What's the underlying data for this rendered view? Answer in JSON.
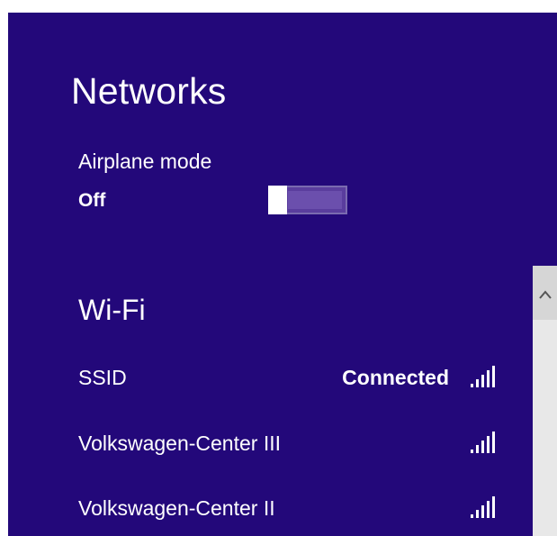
{
  "panel": {
    "title": "Networks",
    "background_color": "#23087a"
  },
  "airplane_mode": {
    "label": "Airplane mode",
    "state": "Off",
    "enabled": false
  },
  "wifi": {
    "heading": "Wi-Fi",
    "networks": [
      {
        "name": "SSID",
        "status": "Connected",
        "signal_icon": "wifi-signal-full-icon"
      },
      {
        "name": "Volkswagen-Center III",
        "status": "",
        "signal_icon": "wifi-signal-full-icon"
      },
      {
        "name": "Volkswagen-Center II",
        "status": "",
        "signal_icon": "wifi-signal-full-icon"
      }
    ]
  },
  "scrollbar": {
    "up_icon": "chevron-up-icon"
  }
}
